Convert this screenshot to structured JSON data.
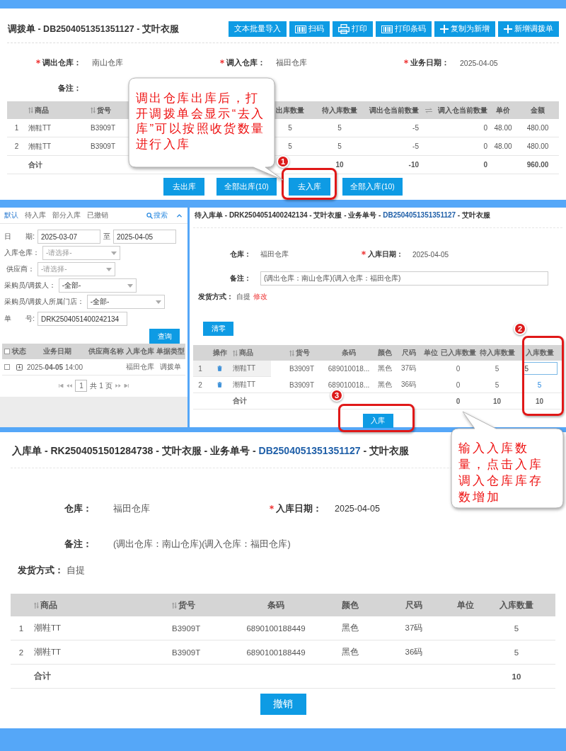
{
  "transfer_order": {
    "title": "调拨单 - DB2504051351351127 - 艾叶衣服",
    "toolbar": [
      {
        "label": "文本批量导入",
        "kind": "text"
      },
      {
        "label": "扫码",
        "kind": "barcode"
      },
      {
        "label": "打印",
        "kind": "printer"
      },
      {
        "label": "打印条码",
        "kind": "barcode"
      },
      {
        "label": "复制为新增",
        "kind": "plus"
      },
      {
        "label": "新增调拨单",
        "kind": "plus"
      }
    ],
    "fields": [
      {
        "label": "调出仓库：",
        "value": "南山仓库",
        "required": true
      },
      {
        "label": "调入仓库：",
        "value": "福田仓库",
        "required": true
      },
      {
        "label": "业务日期：",
        "value": "2025-04-05",
        "required": true
      },
      {
        "label": "备注：",
        "required": false
      }
    ],
    "table": {
      "columns": [
        {
          "label": "商品",
          "sortable": true
        },
        {
          "label": "货号",
          "sortable": true
        },
        {
          "label": "出库数量",
          "sortable": false
        },
        {
          "label": "待入库数量",
          "sortable": false
        },
        {
          "label": "调出仓当前数量",
          "sortable": false
        },
        {
          "label": "调入仓当前数量",
          "sortable": false
        },
        {
          "label": "单价",
          "sortable": false
        },
        {
          "label": "金额",
          "sortable": false
        }
      ],
      "rows": [
        {
          "index": "1",
          "cells": [
            "潮鞋TT",
            "B3909T",
            "5",
            "5",
            "-5",
            "0",
            "48.00",
            "480.00"
          ]
        },
        {
          "index": "2",
          "cells": [
            "潮鞋TT",
            "B3909T",
            "5",
            "5",
            "-5",
            "0",
            "48.00",
            "480.00"
          ]
        }
      ],
      "total": {
        "label": "合计",
        "pending": "10",
        "out_stock": "-10",
        "in_stock": "0",
        "amount": "960.00"
      }
    },
    "buttons": [
      {
        "label": "去出库"
      },
      {
        "label": "全部出库(10)"
      },
      {
        "label": "去入库"
      },
      {
        "label": "全部入库(10)"
      }
    ]
  },
  "receipt_list": {
    "tabs": [
      {
        "label": "默认",
        "selected": true
      },
      {
        "label": "待入库",
        "selected": false
      },
      {
        "label": "部分入库",
        "selected": false
      },
      {
        "label": "已撤销",
        "selected": false
      }
    ],
    "search_label": "搜索",
    "filters": [
      {
        "kind": "date_range",
        "label": "日　　期:",
        "from": "2025-03-07",
        "separator": "至",
        "to": "2025-04-05"
      },
      {
        "kind": "select",
        "label": "入库仓库：",
        "placeholder": "-请选择-"
      },
      {
        "kind": "select",
        "label": "供应商：",
        "placeholder": "-请选择-"
      },
      {
        "kind": "select",
        "label": "采购员/调拨人：",
        "value": "-全部-"
      },
      {
        "kind": "select",
        "label": "采购员/调拨人所属门店：",
        "value": "-全部-"
      },
      {
        "kind": "text",
        "label": "单　　号:",
        "value": "DRK2504051400242134"
      }
    ],
    "query_button": "查询",
    "select_all_checked": false,
    "columns": [
      "状态",
      "业务日期",
      "供应商名称",
      "入库仓库",
      "单据类型"
    ],
    "rows": [
      {
        "checked": false,
        "date": "2025-**04-05** 14:00",
        "warehouse": "福田仓库",
        "type": "调拨单"
      }
    ],
    "pagination": {
      "page": "1",
      "total": "共 1 页"
    }
  },
  "pending_receipt": {
    "title": {
      "prefix": "待入库单 - DRK2504051400242134 - 艾叶衣服 - 业务单号 - ",
      "link": "DB2504051351351127",
      "suffix": " - 艾叶衣服"
    },
    "fields": [
      {
        "label": "仓库：",
        "value": "福田仓库",
        "required": false
      },
      {
        "label": "入库日期：",
        "value": "2025-04-05",
        "required": true
      }
    ],
    "remark": {
      "label": "备注：",
      "value": "(调出仓库：南山仓库)(调入仓库：福田仓库)"
    },
    "shipping": {
      "label": "发货方式：",
      "value": "自提",
      "action": "修改"
    },
    "clear_button": "清零",
    "columns": [
      {
        "label": "操作",
        "sortable": false
      },
      {
        "label": "商品",
        "sortable": true
      },
      {
        "label": "货号",
        "sortable": true
      },
      {
        "label": "条码",
        "sortable": false
      },
      {
        "label": "颜色",
        "sortable": false
      },
      {
        "label": "尺码",
        "sortable": false
      },
      {
        "label": "单位",
        "sortable": false
      },
      {
        "label": "已入库数量",
        "sortable": false
      },
      {
        "label": "待入库数量",
        "sortable": false
      },
      {
        "label": "入库数量",
        "sortable": false
      }
    ],
    "rows": [
      {
        "index": "1",
        "selected": true,
        "cells": [
          "",
          "潮鞋TT",
          "B3909T",
          "689010018...",
          "黑色",
          "37码",
          "",
          "0",
          "5"
        ],
        "quantity": "5",
        "editing": true
      },
      {
        "index": "2",
        "selected": false,
        "cells": [
          "",
          "潮鞋TT",
          "B3909T",
          "689010018...",
          "黑色",
          "36码",
          "",
          "0",
          "5"
        ],
        "quantity": "5",
        "editing": false
      }
    ],
    "total": {
      "label": "合计",
      "received": "0",
      "pending": "10",
      "quantity": "10"
    },
    "submit_button": "入库"
  },
  "receipt": {
    "title": {
      "prefix": "入库单 - RK2504051501284738 - 艾叶衣服 - 业务单号 - ",
      "link": "DB2504051351351127",
      "suffix": " - 艾叶衣服"
    },
    "fields": [
      {
        "label": "仓库：",
        "value": "福田仓库",
        "required": false
      },
      {
        "label": "入库日期：",
        "value": "2025-04-05",
        "required": true
      }
    ],
    "remark": {
      "label": "备注：",
      "value": "(调出仓库：南山仓库)(调入仓库：福田仓库)"
    },
    "shipping": {
      "label": "发货方式：",
      "value": "自提"
    },
    "columns": [
      {
        "label": "商品",
        "sortable": true
      },
      {
        "label": "货号",
        "sortable": true
      },
      {
        "label": "条码",
        "sortable": false
      },
      {
        "label": "颜色",
        "sortable": false
      },
      {
        "label": "尺码",
        "sortable": false
      },
      {
        "label": "单位",
        "sortable": false
      },
      {
        "label": "入库数量",
        "sortable": false
      }
    ],
    "rows": [
      {
        "index": "1",
        "cells": [
          "潮鞋TT",
          "B3909T",
          "6890100188449",
          "黑色",
          "37码",
          "",
          "5"
        ]
      },
      {
        "index": "2",
        "cells": [
          "潮鞋TT",
          "B3909T",
          "6890100188449",
          "黑色",
          "36码",
          "",
          "5"
        ]
      }
    ],
    "total": {
      "label": "合计",
      "quantity": "10"
    },
    "cancel_button": "撤销"
  },
  "annotations": {
    "callouts": [
      {
        "text": "调出仓库出库后，打开调拨单会显示“去入库”可以按照收货数量进行入库"
      },
      {
        "text": "输入入库数量，点击入库调入仓库库存数增加"
      }
    ],
    "steps": [
      {
        "number": "1"
      },
      {
        "number": "2"
      },
      {
        "number": "3"
      }
    ]
  }
}
